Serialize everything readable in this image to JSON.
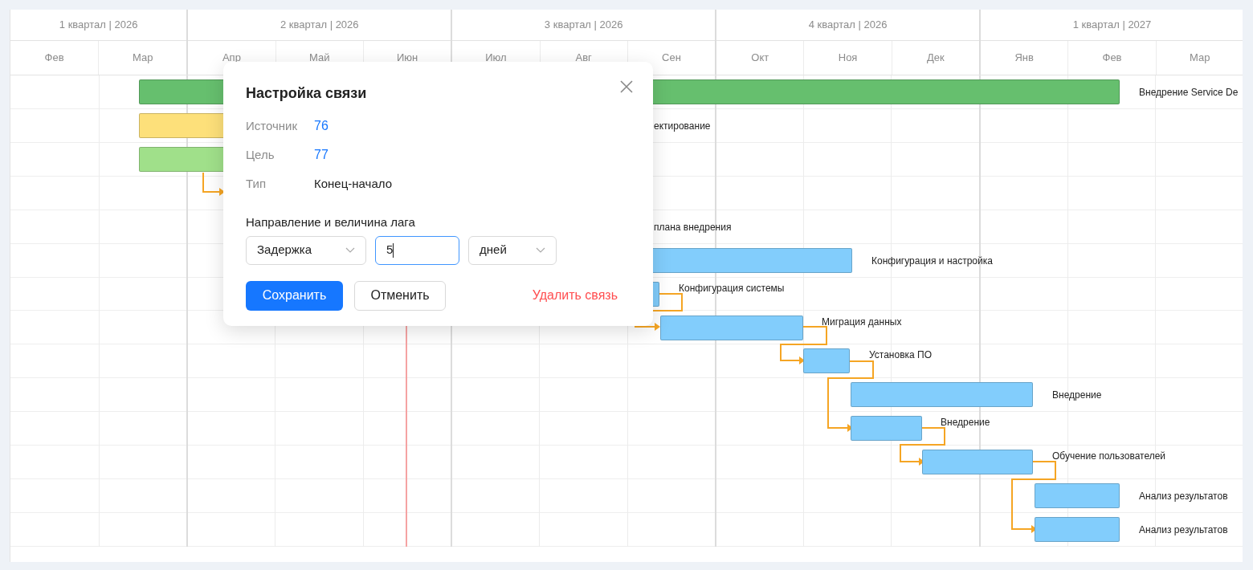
{
  "timeline": {
    "quarters": [
      {
        "label": "1 квартал | 2026",
        "months": [
          "Фев",
          "Мар"
        ]
      },
      {
        "label": "2 квартал | 2026",
        "months": [
          "Апр",
          "Май",
          "Июн"
        ]
      },
      {
        "label": "3 квартал | 2026",
        "months": [
          "Июл",
          "Авг",
          "Сен"
        ]
      },
      {
        "label": "4 квартал | 2026",
        "months": [
          "Окт",
          "Ноя",
          "Дек"
        ]
      },
      {
        "label": "1 квартал | 2027",
        "months": [
          "Янв",
          "Фев",
          "Мар"
        ]
      }
    ]
  },
  "tasks": [
    {
      "label": "Внедрение Service De",
      "color": "#66bf6e"
    },
    {
      "label": "ектирование",
      "color": "#fde07a"
    },
    {
      "color": "#a0e08a"
    },
    {
      "label": "плана внедрения"
    },
    {
      "label": "Конфигурация и настройка",
      "color": "#82cdfc"
    },
    {
      "label": "Конфигурация системы",
      "color": "#82cdfc"
    },
    {
      "label": "Миграция данных",
      "color": "#82cdfc"
    },
    {
      "label": "Установка ПО",
      "color": "#82cdfc"
    },
    {
      "label": "Внедрение",
      "color": "#82cdfc"
    },
    {
      "label": "Внедрение",
      "color": "#82cdfc"
    },
    {
      "label": "Обучение пользователей",
      "color": "#82cdfc"
    },
    {
      "label": "Анализ результатов",
      "color": "#82cdfc"
    },
    {
      "label": "Анализ результатов",
      "color": "#82cdfc"
    }
  ],
  "dialog": {
    "title": "Настройка связи",
    "fields": [
      {
        "label": "Источник",
        "value": "76",
        "kind": "link"
      },
      {
        "label": "Цель",
        "value": "77",
        "kind": "link"
      },
      {
        "label": "Тип",
        "value": "Конец-начало",
        "kind": "text"
      }
    ],
    "lag_label": "Направление и величина лага",
    "direction": "Задержка",
    "amount": "5",
    "unit": "дней",
    "save": "Сохранить",
    "cancel": "Отменить",
    "delete": "Удалить связь"
  }
}
